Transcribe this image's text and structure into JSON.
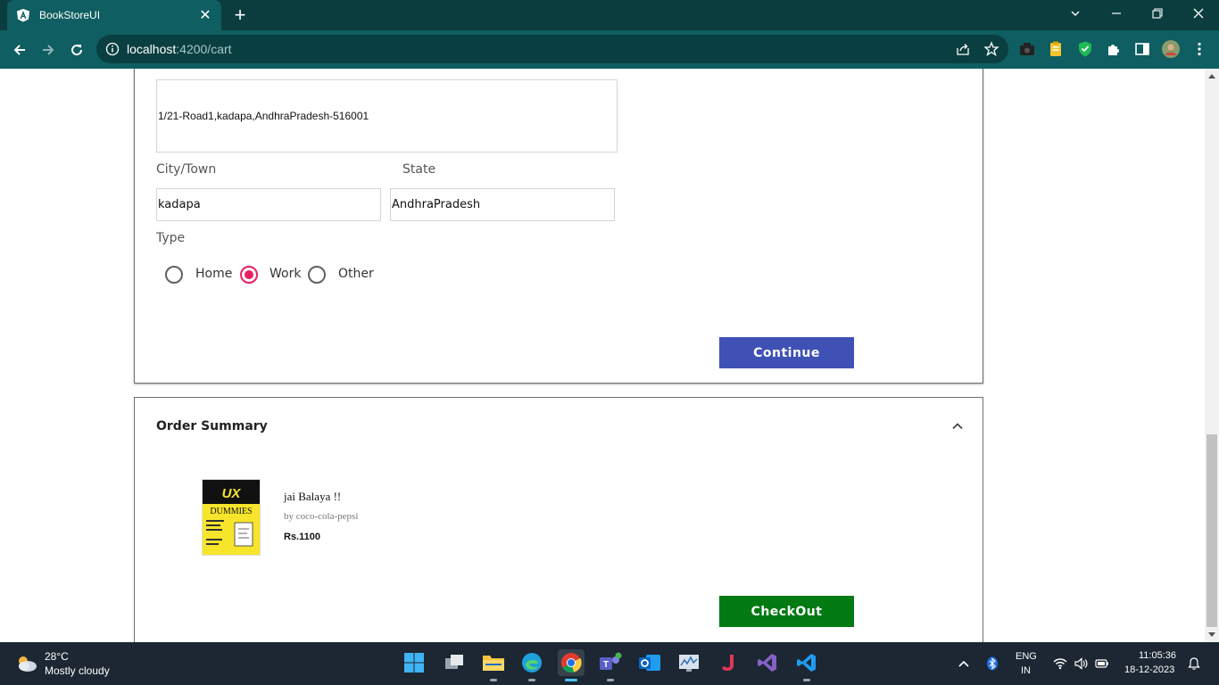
{
  "browser": {
    "tab_title": "BookStoreUI",
    "url_host": "localhost",
    "url_path": ":4200/cart"
  },
  "address_form": {
    "address_value": "1/21-Road1,kadapa,AndhraPradesh-516001",
    "city_label": "City/Town",
    "city_value": "kadapa",
    "state_label": "State",
    "state_value": "AndhraPradesh",
    "type_label": "Type",
    "type_options": [
      {
        "label": "Home",
        "checked": false
      },
      {
        "label": "Work",
        "checked": true
      },
      {
        "label": "Other",
        "checked": false
      }
    ],
    "continue_label": "Continue"
  },
  "order_summary": {
    "title": "Order Summary",
    "book": {
      "cover_title": "UX",
      "cover_subtitle": "DUMMIES",
      "title": "jai Balaya !!",
      "author": "by coco-cola-pepsi",
      "price": "Rs.1100"
    },
    "checkout_label": "CheckOut"
  },
  "taskbar": {
    "temperature": "28°C",
    "weather": "Mostly cloudy",
    "lang_line1": "ENG",
    "lang_line2": "IN",
    "time": "11:05:36",
    "date": "18-12-2023"
  },
  "colors": {
    "continue_button": "#3f51b5",
    "checkout_button": "#047a12",
    "radio_accent": "#e91e63",
    "browser_chrome": "#0f5e61"
  }
}
